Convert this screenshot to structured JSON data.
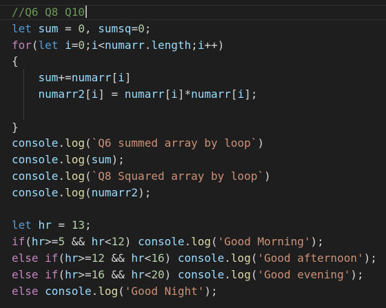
{
  "editor": {
    "colors": {
      "background": "#1e1e1e",
      "default": "#d4d4d4",
      "keyword": "#569cd6",
      "control": "#c586c0",
      "variable": "#9cdcfe",
      "function": "#dcdcaa",
      "number": "#b5cea8",
      "string": "#ce9178",
      "comment": "#6a9955",
      "punctuation": "#d4d4d4"
    },
    "cursor_line": 0,
    "lines": [
      [
        {
          "t": "//Q6 Q8 Q10",
          "c": "comment"
        }
      ],
      [
        {
          "t": "let",
          "c": "keyword"
        },
        {
          "t": " "
        },
        {
          "t": "sum",
          "c": "variable"
        },
        {
          "t": " = "
        },
        {
          "t": "0",
          "c": "number"
        },
        {
          "t": ", "
        },
        {
          "t": "sumsq",
          "c": "variable"
        },
        {
          "t": "="
        },
        {
          "t": "0",
          "c": "number"
        },
        {
          "t": ";"
        }
      ],
      [
        {
          "t": "for",
          "c": "control"
        },
        {
          "t": "("
        },
        {
          "t": "let",
          "c": "keyword"
        },
        {
          "t": " "
        },
        {
          "t": "i",
          "c": "variable"
        },
        {
          "t": "="
        },
        {
          "t": "0",
          "c": "number"
        },
        {
          "t": ";"
        },
        {
          "t": "i",
          "c": "variable"
        },
        {
          "t": "<"
        },
        {
          "t": "numarr",
          "c": "variable"
        },
        {
          "t": "."
        },
        {
          "t": "length",
          "c": "variable"
        },
        {
          "t": ";"
        },
        {
          "t": "i",
          "c": "variable"
        },
        {
          "t": "++)"
        }
      ],
      [
        {
          "t": "{"
        }
      ],
      [
        {
          "t": "    "
        },
        {
          "t": "sum",
          "c": "variable"
        },
        {
          "t": "+="
        },
        {
          "t": "numarr",
          "c": "variable"
        },
        {
          "t": "["
        },
        {
          "t": "i",
          "c": "variable"
        },
        {
          "t": "]"
        }
      ],
      [
        {
          "t": "    "
        },
        {
          "t": "numarr2",
          "c": "variable"
        },
        {
          "t": "["
        },
        {
          "t": "i",
          "c": "variable"
        },
        {
          "t": "] = "
        },
        {
          "t": "numarr",
          "c": "variable"
        },
        {
          "t": "["
        },
        {
          "t": "i",
          "c": "variable"
        },
        {
          "t": "]*"
        },
        {
          "t": "numarr",
          "c": "variable"
        },
        {
          "t": "["
        },
        {
          "t": "i",
          "c": "variable"
        },
        {
          "t": "];"
        }
      ],
      [],
      [
        {
          "t": "}"
        }
      ],
      [
        {
          "t": "console",
          "c": "variable"
        },
        {
          "t": "."
        },
        {
          "t": "log",
          "c": "function"
        },
        {
          "t": "("
        },
        {
          "t": "`Q6 summed array by loop`",
          "c": "string"
        },
        {
          "t": ")"
        }
      ],
      [
        {
          "t": "console",
          "c": "variable"
        },
        {
          "t": "."
        },
        {
          "t": "log",
          "c": "function"
        },
        {
          "t": "("
        },
        {
          "t": "sum",
          "c": "variable"
        },
        {
          "t": ");"
        }
      ],
      [
        {
          "t": "console",
          "c": "variable"
        },
        {
          "t": "."
        },
        {
          "t": "log",
          "c": "function"
        },
        {
          "t": "("
        },
        {
          "t": "`Q8 Squared array by loop`",
          "c": "string"
        },
        {
          "t": ")"
        }
      ],
      [
        {
          "t": "console",
          "c": "variable"
        },
        {
          "t": "."
        },
        {
          "t": "log",
          "c": "function"
        },
        {
          "t": "("
        },
        {
          "t": "numarr2",
          "c": "variable"
        },
        {
          "t": ");"
        }
      ],
      [],
      [
        {
          "t": "let",
          "c": "keyword"
        },
        {
          "t": " "
        },
        {
          "t": "hr",
          "c": "variable"
        },
        {
          "t": " = "
        },
        {
          "t": "13",
          "c": "number"
        },
        {
          "t": ";"
        }
      ],
      [
        {
          "t": "if",
          "c": "control"
        },
        {
          "t": "("
        },
        {
          "t": "hr",
          "c": "variable"
        },
        {
          "t": ">="
        },
        {
          "t": "5",
          "c": "number"
        },
        {
          "t": " && "
        },
        {
          "t": "hr",
          "c": "variable"
        },
        {
          "t": "<"
        },
        {
          "t": "12",
          "c": "number"
        },
        {
          "t": ") "
        },
        {
          "t": "console",
          "c": "variable"
        },
        {
          "t": "."
        },
        {
          "t": "log",
          "c": "function"
        },
        {
          "t": "("
        },
        {
          "t": "'Good Morning'",
          "c": "string"
        },
        {
          "t": ");"
        }
      ],
      [
        {
          "t": "else",
          "c": "control"
        },
        {
          "t": " "
        },
        {
          "t": "if",
          "c": "control"
        },
        {
          "t": "("
        },
        {
          "t": "hr",
          "c": "variable"
        },
        {
          "t": ">="
        },
        {
          "t": "12",
          "c": "number"
        },
        {
          "t": " && "
        },
        {
          "t": "hr",
          "c": "variable"
        },
        {
          "t": "<"
        },
        {
          "t": "16",
          "c": "number"
        },
        {
          "t": ") "
        },
        {
          "t": "console",
          "c": "variable"
        },
        {
          "t": "."
        },
        {
          "t": "log",
          "c": "function"
        },
        {
          "t": "("
        },
        {
          "t": "'Good afternoon'",
          "c": "string"
        },
        {
          "t": ");"
        }
      ],
      [
        {
          "t": "else",
          "c": "control"
        },
        {
          "t": " "
        },
        {
          "t": "if",
          "c": "control"
        },
        {
          "t": "("
        },
        {
          "t": "hr",
          "c": "variable"
        },
        {
          "t": ">="
        },
        {
          "t": "16",
          "c": "number"
        },
        {
          "t": " && "
        },
        {
          "t": "hr",
          "c": "variable"
        },
        {
          "t": "<"
        },
        {
          "t": "20",
          "c": "number"
        },
        {
          "t": ") "
        },
        {
          "t": "console",
          "c": "variable"
        },
        {
          "t": "."
        },
        {
          "t": "log",
          "c": "function"
        },
        {
          "t": "("
        },
        {
          "t": "'Good evening'",
          "c": "string"
        },
        {
          "t": ");"
        }
      ],
      [
        {
          "t": "else",
          "c": "control"
        },
        {
          "t": " "
        },
        {
          "t": "console",
          "c": "variable"
        },
        {
          "t": "."
        },
        {
          "t": "log",
          "c": "function"
        },
        {
          "t": "("
        },
        {
          "t": "'Good Night'",
          "c": "string"
        },
        {
          "t": ");"
        }
      ]
    ]
  }
}
